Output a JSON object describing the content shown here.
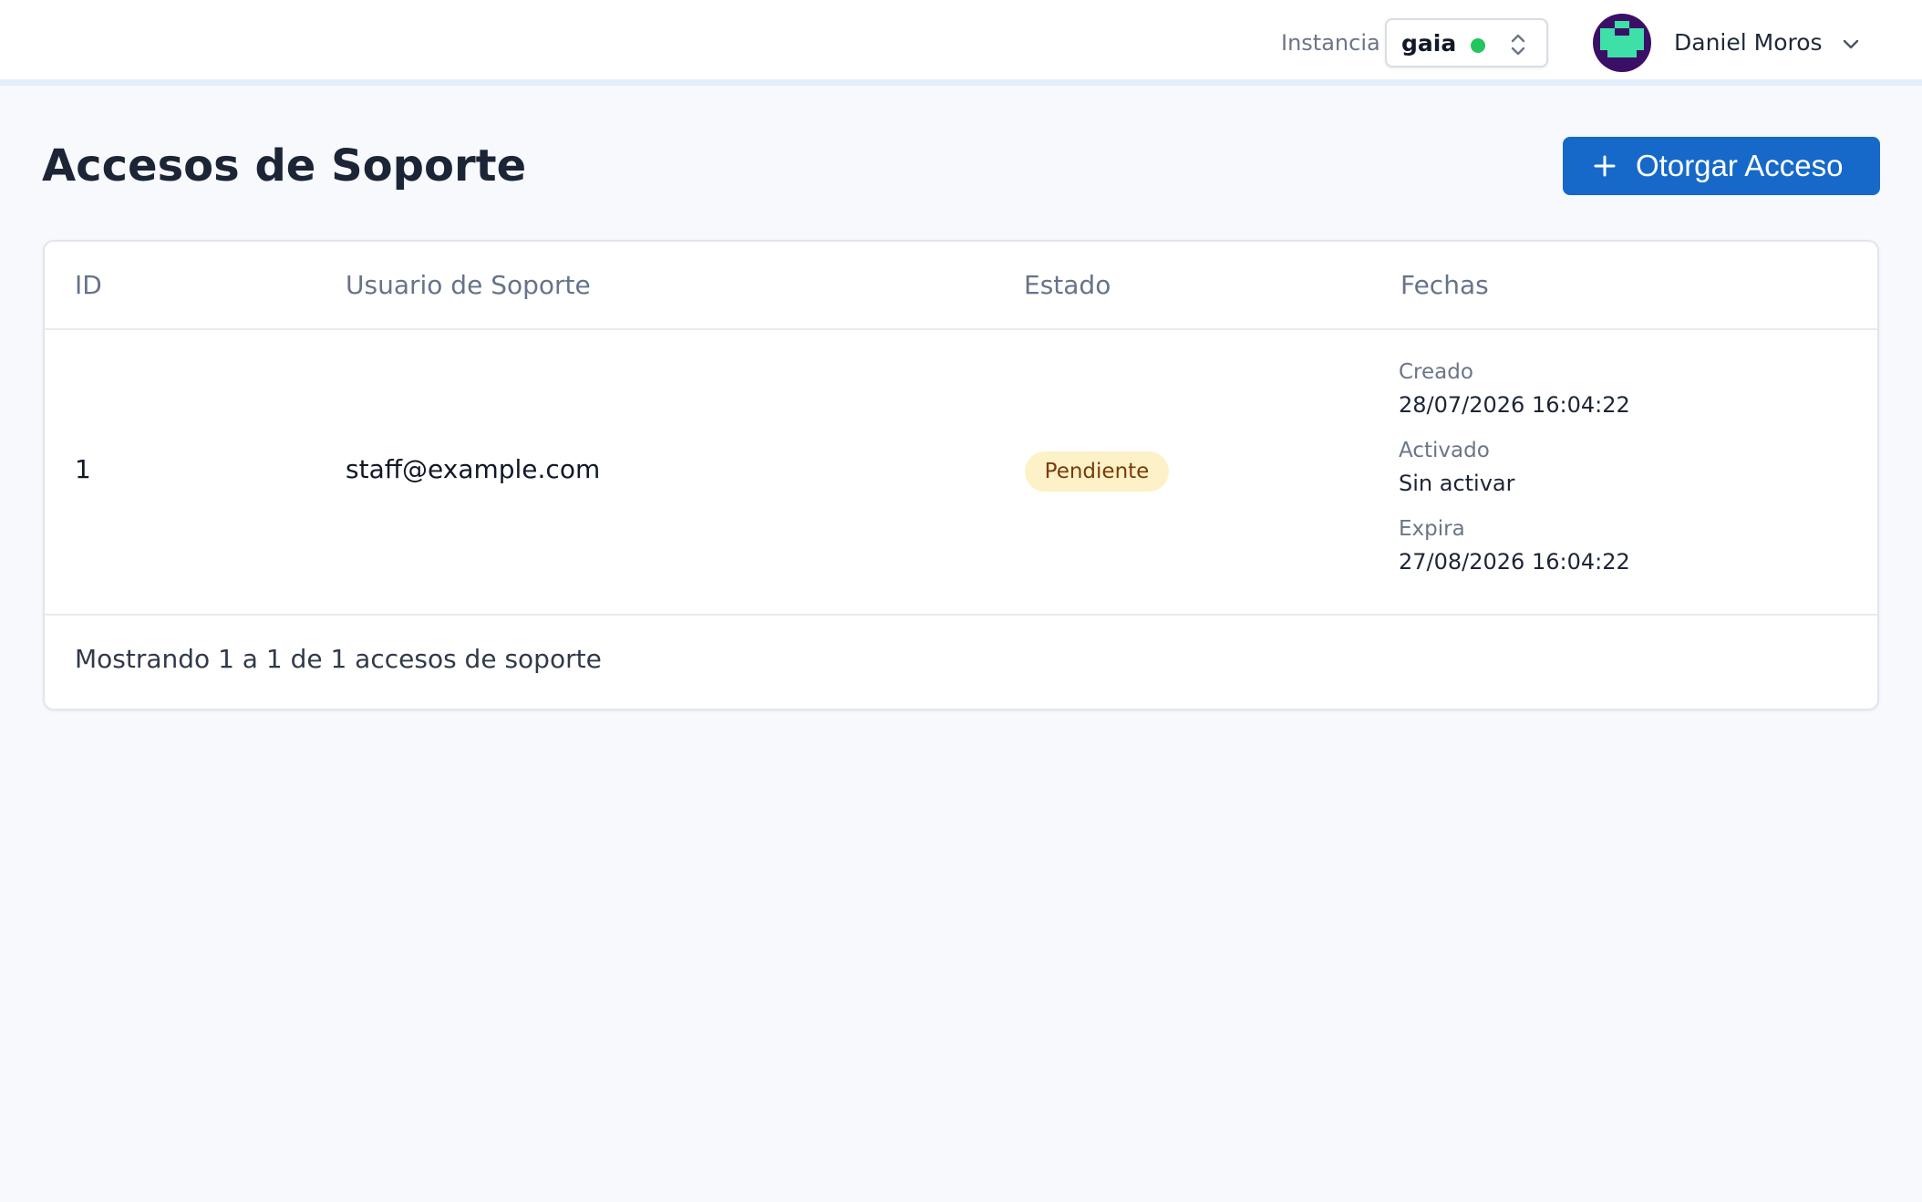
{
  "topbar": {
    "instance_label": "Instancia",
    "instance_name": "gaia",
    "instance_status_color": "#22c55e",
    "user_name": "Daniel Moros"
  },
  "page": {
    "title": "Accesos de Soporte",
    "grant_button_label": "Otorgar Acceso",
    "accent_color": "#1769c9"
  },
  "table": {
    "headers": [
      "ID",
      "Usuario de Soporte",
      "Estado",
      "Fechas"
    ],
    "rows": [
      {
        "id": "1",
        "user": "staff@example.com",
        "status": "Pendiente",
        "created_label": "Creado",
        "created": "28/07/2026 16:04:22",
        "activated_label": "Activado",
        "activated": "Sin activar",
        "expires_label": "Expira",
        "expires": "27/08/2026 16:04:22"
      }
    ],
    "footer": "Mostrando 1 a 1 de 1 accesos de soporte"
  }
}
